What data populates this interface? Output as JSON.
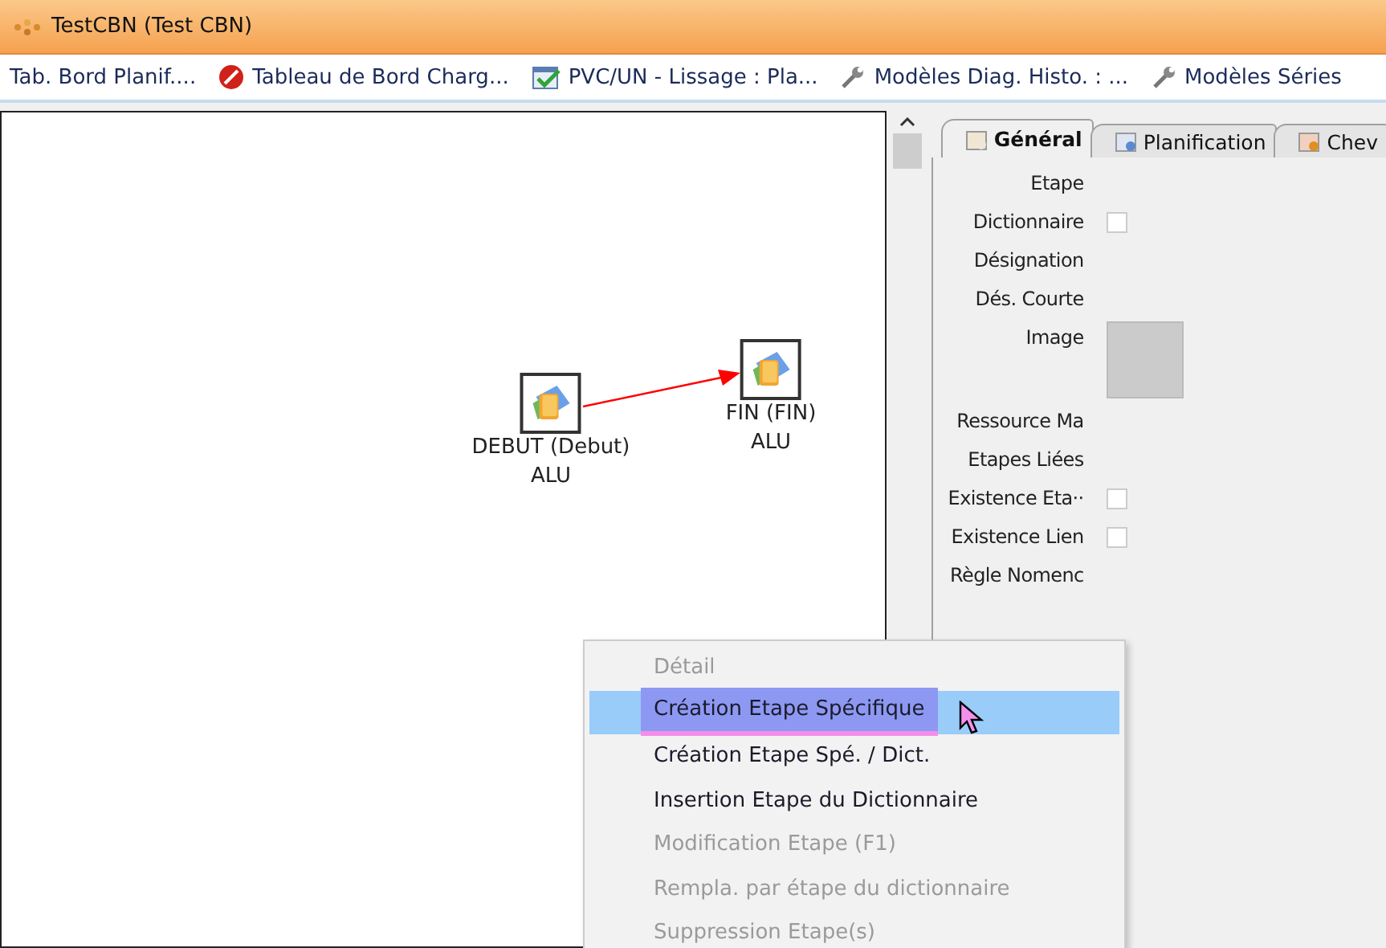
{
  "window": {
    "title": "TestCBN (Test CBN)"
  },
  "toolbar": [
    {
      "label": "Tab. Bord Planif....",
      "kind": "plain"
    },
    {
      "label": "Tableau de Bord Charg...",
      "kind": "board"
    },
    {
      "label": "PVC/UN - Lissage : Pla...",
      "kind": "schedule"
    },
    {
      "label": "Modèles Diag. Histo. : ...",
      "kind": "model"
    },
    {
      "label": "Modèles Séries",
      "kind": "model"
    }
  ],
  "diagram": {
    "nodes": [
      {
        "name": "DEBUT (Debut)",
        "sub": "ALU"
      },
      {
        "name": "FIN (FIN)",
        "sub": "ALU"
      }
    ]
  },
  "panel": {
    "tabs": [
      {
        "label": "Général",
        "selected": true
      },
      {
        "label": "Planification",
        "selected": false
      },
      {
        "label": "Chev",
        "selected": false
      }
    ],
    "fields": [
      {
        "label": "Etape",
        "kind": "text"
      },
      {
        "label": "Dictionnaire",
        "kind": "checkbox",
        "checked": false
      },
      {
        "label": "Désignation",
        "kind": "text"
      },
      {
        "label": "Dés. Courte",
        "kind": "text"
      },
      {
        "label": "Image",
        "kind": "image"
      },
      {
        "label": "Ressource Ma",
        "kind": "text"
      },
      {
        "label": "Etapes Liées",
        "kind": "text"
      },
      {
        "label": "Existence Eta··",
        "kind": "checkbox",
        "checked": false
      },
      {
        "label": "Existence Lien",
        "kind": "checkbox",
        "checked": false
      },
      {
        "label": "Règle Nomenc",
        "kind": "text"
      }
    ]
  },
  "context_menu": {
    "items": [
      {
        "label": "Détail",
        "disabled": true,
        "selected": false
      },
      {
        "label": "Création Etape Spécifique",
        "disabled": false,
        "selected": true
      },
      {
        "label": "Création Etape Spé. / Dict.",
        "disabled": false,
        "selected": false
      },
      {
        "label": "Insertion Etape du Dictionnaire",
        "disabled": false,
        "selected": false
      },
      {
        "label": "Modification Etape (F1)",
        "disabled": true,
        "selected": false
      },
      {
        "label": "Rempla. par étape du dictionnaire",
        "disabled": true,
        "selected": false
      },
      {
        "label": "Suppression Etape(s)",
        "disabled": true,
        "selected": false
      }
    ]
  }
}
